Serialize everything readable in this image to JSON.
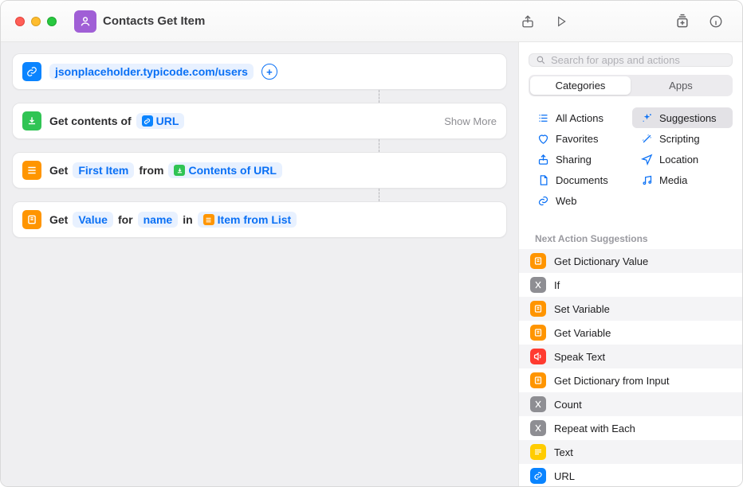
{
  "window": {
    "title": "Contacts Get Item"
  },
  "actions": [
    {
      "url_text": "jsonplaceholder.typicode.com/users"
    },
    {
      "prefix": "Get contents of",
      "token_label": "URL",
      "show_more": "Show More"
    },
    {
      "word_get": "Get",
      "first_item": "First Item",
      "word_from": "from",
      "contents_label": "Contents of URL"
    },
    {
      "word_get": "Get",
      "value": "Value",
      "word_for": "for",
      "name": "name",
      "word_in": "in",
      "item_label": "Item from List"
    }
  ],
  "sidebar": {
    "search_placeholder": "Search for apps and actions",
    "tabs": {
      "categories": "Categories",
      "apps": "Apps"
    },
    "categories": [
      {
        "label": "All Actions"
      },
      {
        "label": "Suggestions",
        "selected": true
      },
      {
        "label": "Favorites"
      },
      {
        "label": "Scripting"
      },
      {
        "label": "Sharing"
      },
      {
        "label": "Location"
      },
      {
        "label": "Documents"
      },
      {
        "label": "Media"
      },
      {
        "label": "Web"
      }
    ],
    "section_label": "Next Action Suggestions",
    "suggestions": [
      {
        "label": "Get Dictionary Value",
        "color": "orange"
      },
      {
        "label": "If",
        "color": "gray"
      },
      {
        "label": "Set Variable",
        "color": "orange"
      },
      {
        "label": "Get Variable",
        "color": "orange"
      },
      {
        "label": "Speak Text",
        "color": "red"
      },
      {
        "label": "Get Dictionary from Input",
        "color": "orange"
      },
      {
        "label": "Count",
        "color": "gray"
      },
      {
        "label": "Repeat with Each",
        "color": "gray"
      },
      {
        "label": "Text",
        "color": "yellow"
      },
      {
        "label": "URL",
        "color": "blue"
      }
    ]
  }
}
